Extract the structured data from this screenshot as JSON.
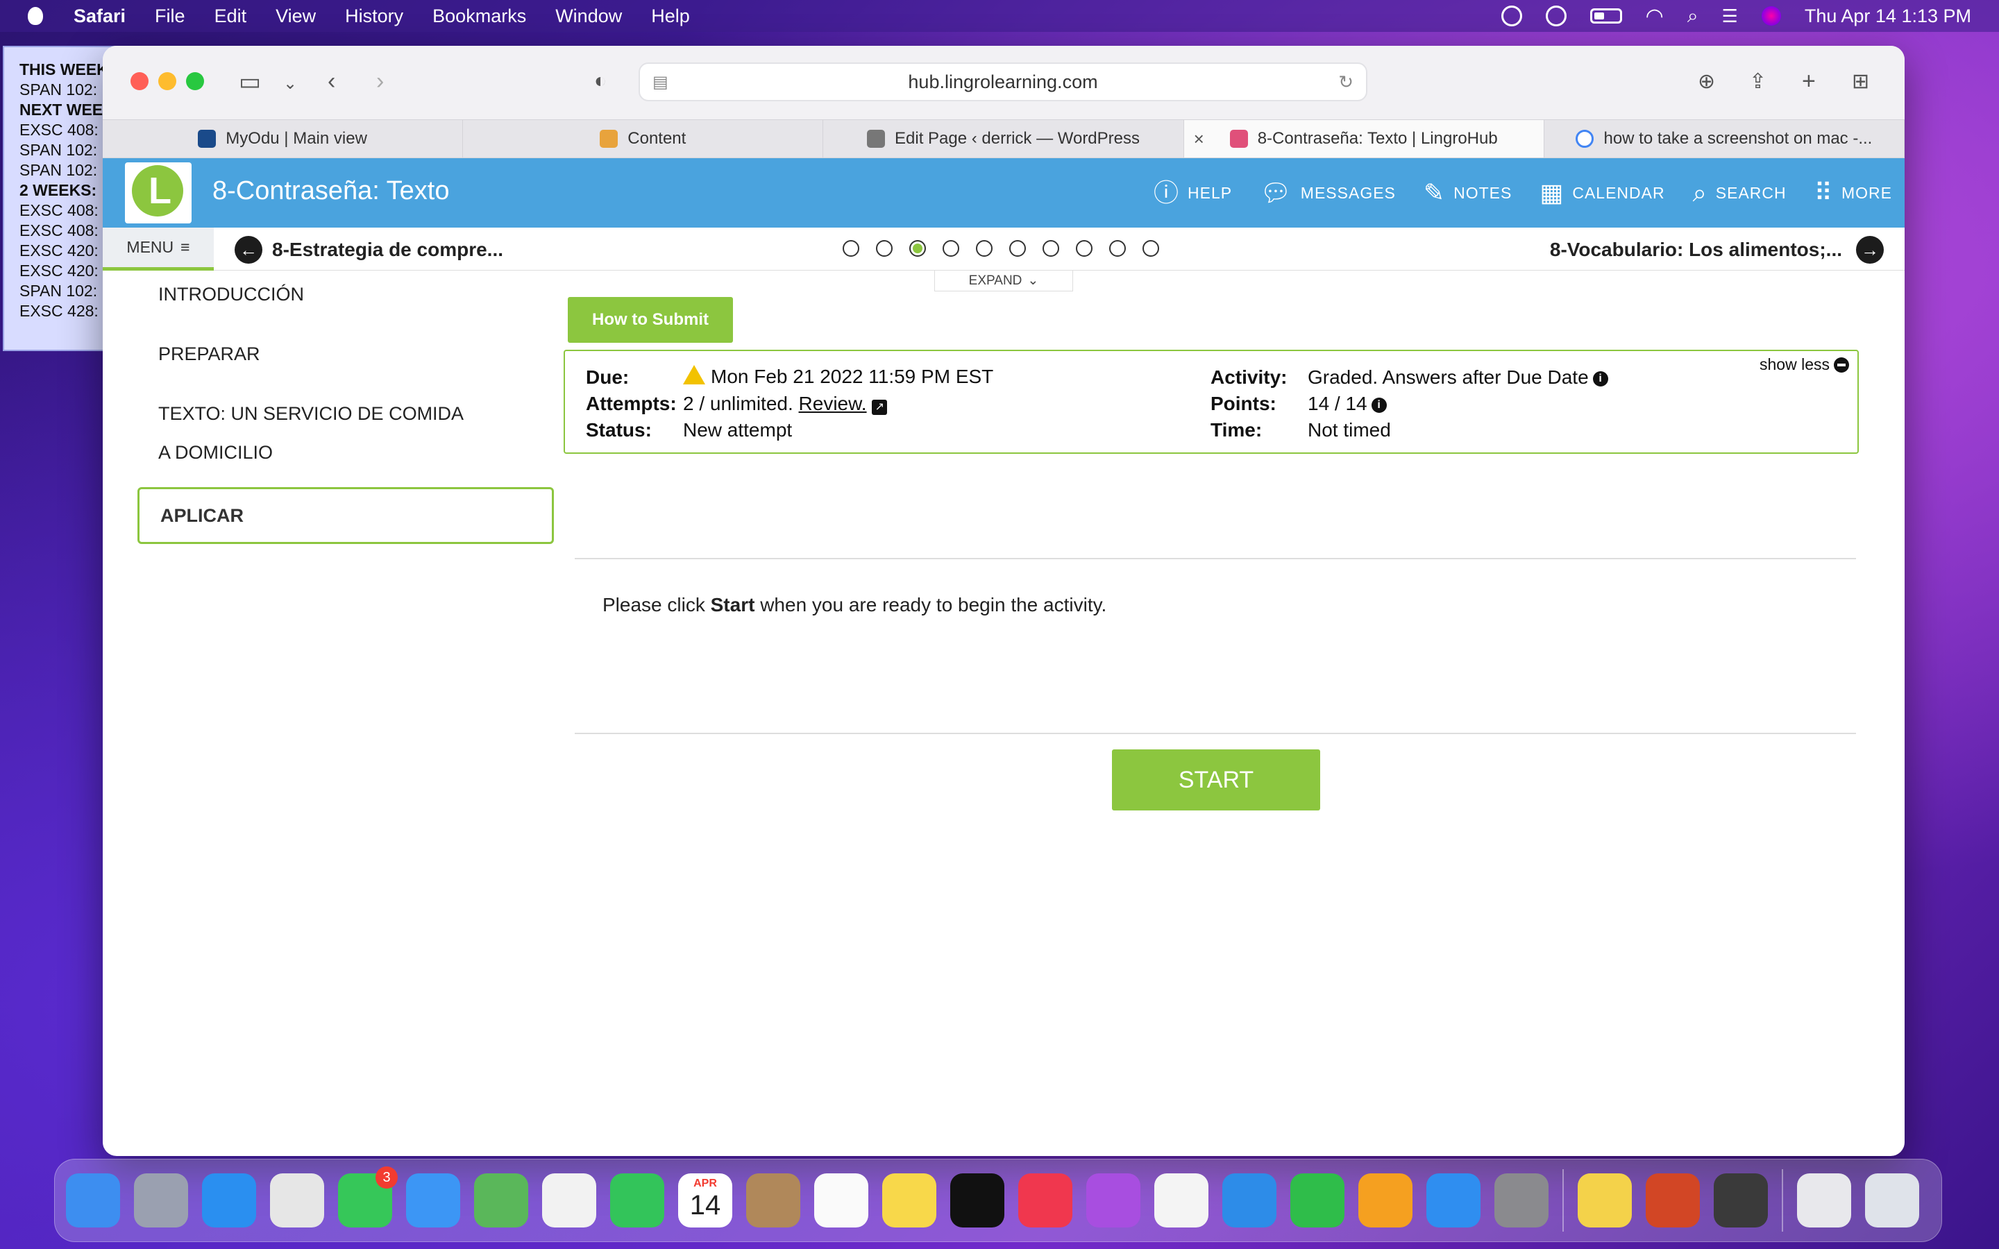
{
  "menubar": {
    "app": "Safari",
    "items": [
      "File",
      "Edit",
      "View",
      "History",
      "Bookmarks",
      "Window",
      "Help"
    ],
    "clock": "Thu Apr 14  1:13 PM"
  },
  "widget": {
    "lines": [
      {
        "text": "THIS WEEK",
        "bold": true
      },
      {
        "text": "SPAN 102:",
        "bold": false
      },
      {
        "text": "NEXT WEE",
        "bold": true
      },
      {
        "text": "EXSC 408:",
        "bold": false
      },
      {
        "text": "SPAN 102:",
        "bold": false
      },
      {
        "text": "SPAN 102:",
        "bold": false
      },
      {
        "text": "2 WEEKS:",
        "bold": true
      },
      {
        "text": "EXSC 408:",
        "bold": false
      },
      {
        "text": "EXSC 408:",
        "bold": false
      },
      {
        "text": "EXSC 420:",
        "bold": false
      },
      {
        "text": "EXSC 420:",
        "bold": false
      },
      {
        "text": "SPAN 102:",
        "bold": false
      },
      {
        "text": "EXSC 428:",
        "bold": false
      }
    ]
  },
  "browser": {
    "url": "hub.lingrolearning.com",
    "tabs": [
      {
        "label": "MyOdu | Main view",
        "fav_color": "#1a4a8a"
      },
      {
        "label": "Content",
        "fav_color": "#e8a33c"
      },
      {
        "label": "Edit Page ‹ derrick — WordPress",
        "fav_color": "#777777"
      },
      {
        "label": "8-Contraseña: Texto | LingroHub",
        "fav_color": "#e0507a",
        "active": true
      },
      {
        "label": "how to take a screenshot on mac -...",
        "fav_color": "#4285f4"
      }
    ]
  },
  "app": {
    "title": "8-Contraseña: Texto",
    "nav": {
      "help": "HELP",
      "messages": "MESSAGES",
      "notes": "NOTES",
      "calendar": "CALENDAR",
      "search": "SEARCH",
      "more": "MORE"
    },
    "menu_label": "MENU",
    "prev_label": "8-Estrategia de compre...",
    "next_label": "8-Vocabulario: Los alimentos;...",
    "progress": {
      "total": 10,
      "current_index": 2
    },
    "expand_label": "EXPAND",
    "accent": "#8cc63f",
    "header_color": "#4aa3de"
  },
  "sidebar": {
    "items": [
      "INTRODUCCIÓN",
      "PREPARAR",
      "TEXTO: UN SERVICIO DE COMIDA A DOMICILIO",
      "APLICAR"
    ],
    "active_index": 3
  },
  "activity": {
    "how_to_submit": "How to Submit",
    "show_less": "show less",
    "due_label": "Due:",
    "due_value": "Mon Feb 21 2022 11:59 PM EST",
    "attempts_label": "Attempts:",
    "attempts_value": "2 / unlimited.",
    "review_link": "Review.",
    "status_label": "Status:",
    "status_value": "New attempt",
    "activity_label": "Activity:",
    "activity_value": "Graded. Answers after Due Date",
    "points_label": "Points:",
    "points_value": "14 / 14",
    "time_label": "Time:",
    "time_value": "Not timed",
    "prompt_pre": "Please click ",
    "prompt_bold": "Start",
    "prompt_post": " when you are ready to begin the activity.",
    "start_label": "START"
  },
  "dock": {
    "calendar_month": "APR",
    "calendar_day": "14",
    "messages_badge": "3",
    "apps": [
      {
        "name": "finder-icon",
        "color": "#3d8ef0"
      },
      {
        "name": "launchpad-icon",
        "color": "#9aa0b0"
      },
      {
        "name": "safari-icon",
        "color": "#2a8ff0"
      },
      {
        "name": "chrome-icon",
        "color": "#e6e6e6"
      },
      {
        "name": "messages-icon",
        "color": "#36c759"
      },
      {
        "name": "mail-icon",
        "color": "#3c96f5"
      },
      {
        "name": "maps-icon",
        "color": "#5ab75a"
      },
      {
        "name": "photos-icon",
        "color": "#f2f2f2"
      },
      {
        "name": "facetime-icon",
        "color": "#33c45a"
      },
      {
        "name": "calendar-icon",
        "color": "#ffffff"
      },
      {
        "name": "contacts-icon",
        "color": "#b0885a"
      },
      {
        "name": "reminders-icon",
        "color": "#fafafa"
      },
      {
        "name": "notes-icon",
        "color": "#f8d84a"
      },
      {
        "name": "apple-tv-icon",
        "color": "#111111"
      },
      {
        "name": "music-icon",
        "color": "#f0374e"
      },
      {
        "name": "podcasts-icon",
        "color": "#a84ee0"
      },
      {
        "name": "news-icon",
        "color": "#f4f4f4"
      },
      {
        "name": "keynote-icon",
        "color": "#2d8ce8"
      },
      {
        "name": "numbers-icon",
        "color": "#2fbd4a"
      },
      {
        "name": "pages-icon",
        "color": "#f5a020"
      },
      {
        "name": "app-store-icon",
        "color": "#2f8ef0"
      },
      {
        "name": "system-preferences-icon",
        "color": "#8a8a8e"
      },
      {
        "name": "stickies-icon",
        "color": "#f4d24a"
      },
      {
        "name": "powerpoint-icon",
        "color": "#d24625"
      },
      {
        "name": "quicktime-icon",
        "color": "#3a3a3a"
      },
      {
        "name": "music-file-icon",
        "color": "#e8e8ec"
      },
      {
        "name": "trash-icon",
        "color": "#dfe3ea"
      }
    ]
  }
}
